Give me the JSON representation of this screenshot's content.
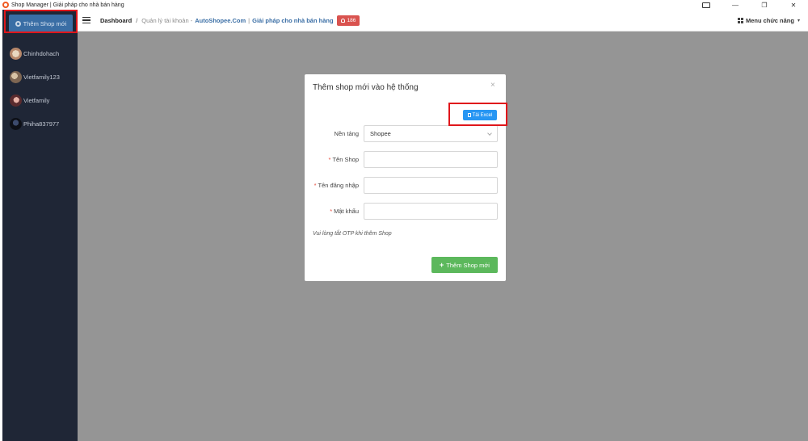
{
  "window": {
    "title": "Shop Manager | Giải pháp cho nhà bán hàng",
    "controls": {
      "minimize": "—",
      "restore": "❐",
      "close": "✕"
    }
  },
  "sidebar": {
    "add_button_label": "Thêm Shop mới",
    "shops": [
      {
        "name": "Chinhdohach"
      },
      {
        "name": "Vietfamily123"
      },
      {
        "name": "Vietfamily"
      },
      {
        "name": "Phiha837977"
      }
    ]
  },
  "header": {
    "breadcrumb_home": "Dashboard",
    "breadcrumb_separator": "/",
    "breadcrumb_page": "Quản lý tài khoản -",
    "brand": "AutoShopee.Com",
    "brand_separator": "|",
    "slogan": "Giải pháp cho nhà bán hàng",
    "notification_count": "186",
    "function_menu_label": "Menu chức năng",
    "function_menu_caret": "▾"
  },
  "modal": {
    "title": "Thêm shop mới vào hệ thống",
    "close_symbol": "×",
    "excel_button_label": "Tải Excel",
    "fields": {
      "platform": {
        "label": "Nền tảng",
        "value": "Shopee"
      },
      "shop_name": {
        "label": "Tên Shop",
        "value": "",
        "required_mark": "*"
      },
      "username": {
        "label": "Tên đăng nhập",
        "value": "",
        "required_mark": "*"
      },
      "password": {
        "label": "Mật khẩu",
        "value": "",
        "required_mark": "*"
      }
    },
    "note": "Vui lòng tắt OTP khi thêm Shop",
    "submit_label": "Thêm Shop mới",
    "submit_icon": "+"
  },
  "colors": {
    "sidebar_bg": "#1f2636",
    "primary_blue": "#3a6ea5",
    "excel_blue": "#2796f3",
    "submit_green": "#5cb85c",
    "badge_red": "#d9534f",
    "highlight_red": "#e0161b",
    "overlay_gray": "#959595"
  },
  "icons": {
    "app": "shopee-icon",
    "menu": "hamburger-icon",
    "notification": "bell-icon",
    "function_menu": "grid-icon",
    "excel": "file-icon",
    "close": "close-icon",
    "submit": "plus-icon"
  }
}
